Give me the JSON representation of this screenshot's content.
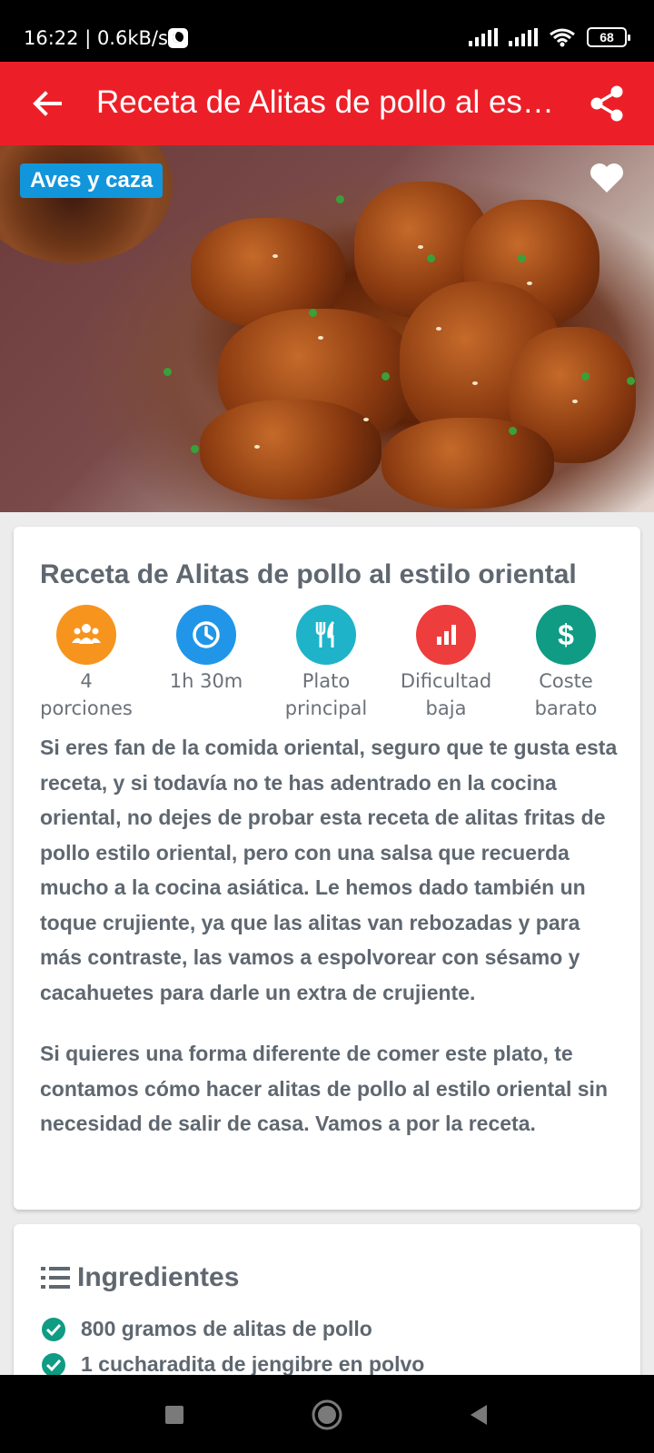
{
  "status_bar": {
    "time": "16:22 | 0.6kB/s",
    "battery": "68",
    "icons": [
      "moon-icon",
      "signal-icon",
      "signal-icon",
      "wifi-icon",
      "battery-icon"
    ]
  },
  "app_bar": {
    "title": "Receta de Alitas de pollo al estilo oriental",
    "back_icon": "arrow-left-icon",
    "share_icon": "share-icon",
    "color": "#ec1f28"
  },
  "hero": {
    "category": "Aves y caza",
    "category_color": "#1296db",
    "favorite_icon": "heart-icon"
  },
  "recipe": {
    "title": "Receta de Alitas de pollo al estilo oriental",
    "stats": [
      {
        "icon": "people-icon",
        "label": "4\nporciones",
        "color": "#f7941d"
      },
      {
        "icon": "clock-icon",
        "label": "1h 30m",
        "color": "#2196e8"
      },
      {
        "icon": "cutlery-icon",
        "label": "Plato\nprincipal",
        "color": "#1eb3c9"
      },
      {
        "icon": "bar-chart-icon",
        "label": "Dificultad\nbaja",
        "color": "#ee3d3d"
      },
      {
        "icon": "dollar-icon",
        "label": "Coste\nbarato",
        "color": "#0f9b84"
      }
    ],
    "description": [
      "Si eres fan de la comida oriental, seguro que te gusta esta receta, y si todavía no te has adentrado en la cocina oriental, no dejes de probar esta receta de alitas fritas de pollo estilo oriental, pero con una salsa que recuerda mucho a la cocina asiática. Le hemos dado también un toque crujiente, ya que las alitas van rebozadas y para más contraste, las vamos a espolvorear con sésamo y cacahuetes para darle un extra de crujiente.",
      "Si quieres una forma diferente de comer este plato, te contamos cómo hacer alitas de pollo al estilo oriental sin necesidad de salir de casa. Vamos a por la receta."
    ]
  },
  "ingredients": {
    "title": "Ingredientes",
    "icon": "list-icon",
    "check_color": "#0f9b84",
    "items": [
      "800 gramos de alitas de pollo",
      "1 cucharadita de jengibre en polvo"
    ]
  },
  "nav_bar": {
    "icons": [
      "recents-square-icon",
      "home-circle-icon",
      "back-triangle-icon"
    ]
  }
}
